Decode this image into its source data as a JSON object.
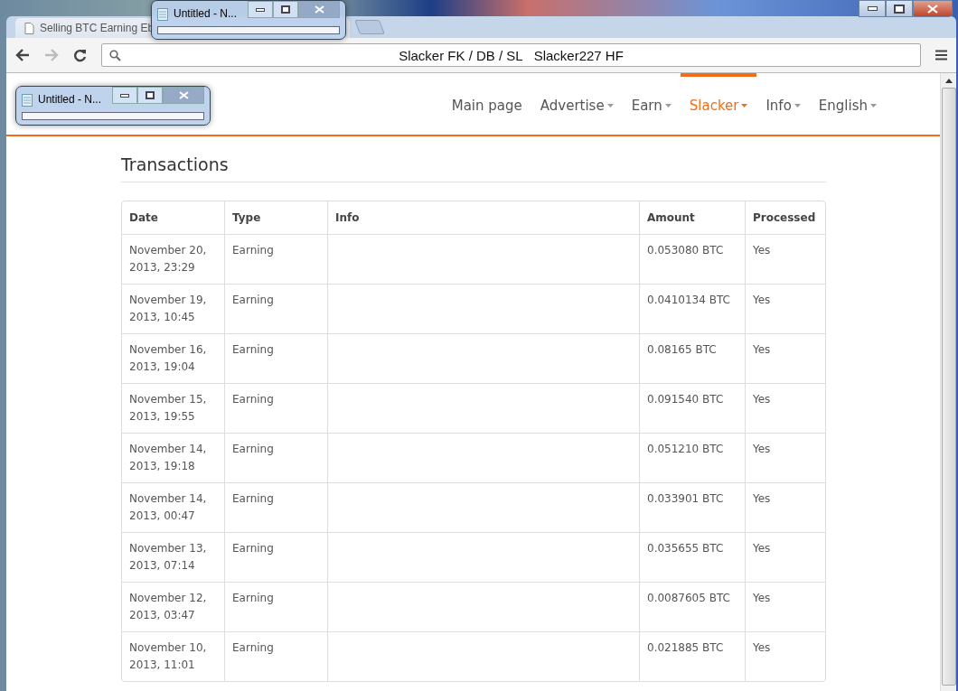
{
  "browser": {
    "tab_title": "Selling BTC Earning Eb",
    "address": "Slacker FK / DB / SL   Slacker227 HF"
  },
  "notepads": [
    {
      "title": "Untitled - N..."
    },
    {
      "title": "Untitled - N..."
    }
  ],
  "nav": [
    {
      "label": "Main page",
      "dropdown": false,
      "selected": false
    },
    {
      "label": "Advertise",
      "dropdown": true,
      "selected": false
    },
    {
      "label": "Earn",
      "dropdown": true,
      "selected": false
    },
    {
      "label": "Slacker",
      "dropdown": true,
      "selected": true
    },
    {
      "label": "Info",
      "dropdown": true,
      "selected": false
    },
    {
      "label": "English",
      "dropdown": true,
      "selected": false
    }
  ],
  "heading": "Transactions",
  "table": {
    "columns": [
      "Date",
      "Type",
      "Info",
      "Amount",
      "Processed"
    ],
    "rows": [
      [
        "November 20, 2013, 23:29",
        "Earning",
        "",
        "0.053080 BTC",
        "Yes"
      ],
      [
        "November 19, 2013, 10:45",
        "Earning",
        "",
        "0.0410134 BTC",
        "Yes"
      ],
      [
        "November 16, 2013, 19:04",
        "Earning",
        "",
        "0.08165 BTC",
        "Yes"
      ],
      [
        "November 15, 2013, 19:55",
        "Earning",
        "",
        "0.091540 BTC",
        "Yes"
      ],
      [
        "November 14, 2013, 19:18",
        "Earning",
        "",
        "0.051210 BTC",
        "Yes"
      ],
      [
        "November 14, 2013, 00:47",
        "Earning",
        "",
        "0.033901 BTC",
        "Yes"
      ],
      [
        "November 13, 2013, 07:14",
        "Earning",
        "",
        "0.035655 BTC",
        "Yes"
      ],
      [
        "November 12, 2013, 03:47",
        "Earning",
        "",
        "0.0087605 BTC",
        "Yes"
      ],
      [
        "November 10, 2013, 11:01",
        "Earning",
        "",
        "0.021885 BTC",
        "Yes"
      ]
    ]
  }
}
